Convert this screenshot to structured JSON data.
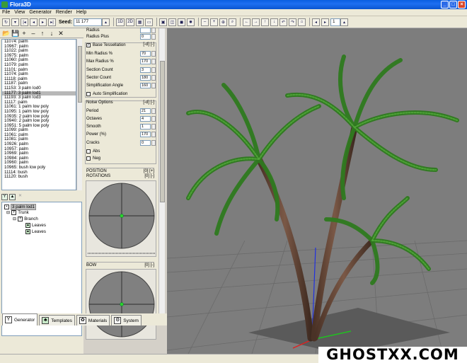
{
  "app": {
    "title": "Flora3D"
  },
  "menu": [
    "File",
    "View",
    "Generator",
    "Render",
    "Help"
  ],
  "toolbar": {
    "seed_label": "Seed:",
    "seed_value": "11 177",
    "btn_1d": "1D",
    "btn_2d": "2D",
    "level_value": "1"
  },
  "object_list": [
    "11074: palm",
    "10967: palm",
    "11022: palm",
    "10975: palm",
    "11060: palm",
    "11079: palm",
    "11101: palm",
    "11074: palm",
    "11118: palm",
    "11187: palm",
    "11153: 3 palm lod0",
    "11177: 3 palm lod1",
    "11193: 3 palm lod3",
    "11117: palm",
    "11061: 1 palm low poly",
    "11095: 1 palm low poly",
    "10935: 2 palm low poly",
    "10940: 2 palm low poly",
    "10951: 5 palm low poly",
    "11099: palm",
    "11061: palm",
    "11081: palm",
    "10926: palm",
    "10957: palm",
    "10969: palm",
    "10984: palm",
    "10960: palm",
    "10965: bush low poly",
    "11114: bush",
    "11120: bush"
  ],
  "selected_object_index": 11,
  "tree": {
    "root": "3 palm lod1",
    "trunk": "Trunk",
    "branch": "Branch",
    "leaves1": "Leaves",
    "leaves2": "Leaves"
  },
  "tabs": [
    "Generator",
    "Templates",
    "Materials",
    "System"
  ],
  "active_tab": 0,
  "props": {
    "radius_label": "Radius",
    "radius_plus_label": "Radius Plus",
    "radius_plus": "0",
    "base_tess_label": "Base Tessellation",
    "base_tess_ctrl": "[-d] [-]",
    "min_radius_label": "Min Radius %",
    "min_radius": "70",
    "max_radius_label": "Max Radius %",
    "max_radius": "170",
    "section_count_label": "Section Count",
    "section_count": "3",
    "sector_count_label": "Sector Count",
    "sector_count": "180",
    "simplification_label": "Simplification Angle",
    "simplification": "160",
    "auto_simplification_label": "Auto Simplification",
    "noise_label": "Noise Options",
    "noise_ctrl": "[-d] [-]",
    "period_label": "Period",
    "period": "21",
    "octaves_label": "Octaves",
    "octaves": "4",
    "smooth_label": "Smooth",
    "smooth": "1",
    "power_label": "Power (%)",
    "power": "170",
    "cracks_label": "Cracks",
    "cracks": "0",
    "abs_label": "Abs",
    "neg_label": "Neg"
  },
  "position": {
    "label": "POSITION",
    "ctrl": "[0] [+]"
  },
  "rotations": {
    "label": "ROTATIONS",
    "ctrl": "[0] [-]"
  },
  "bow": {
    "label": "BOW",
    "ctrl": "[0] [-]"
  },
  "watermark": "GHOSTXX.COM",
  "colors": {
    "title_bar": "#0a5ee0",
    "viewport_bg": "#7d7d7d",
    "leaf_green": "#3d8a2a",
    "trunk_brown": "#6b4a38"
  }
}
